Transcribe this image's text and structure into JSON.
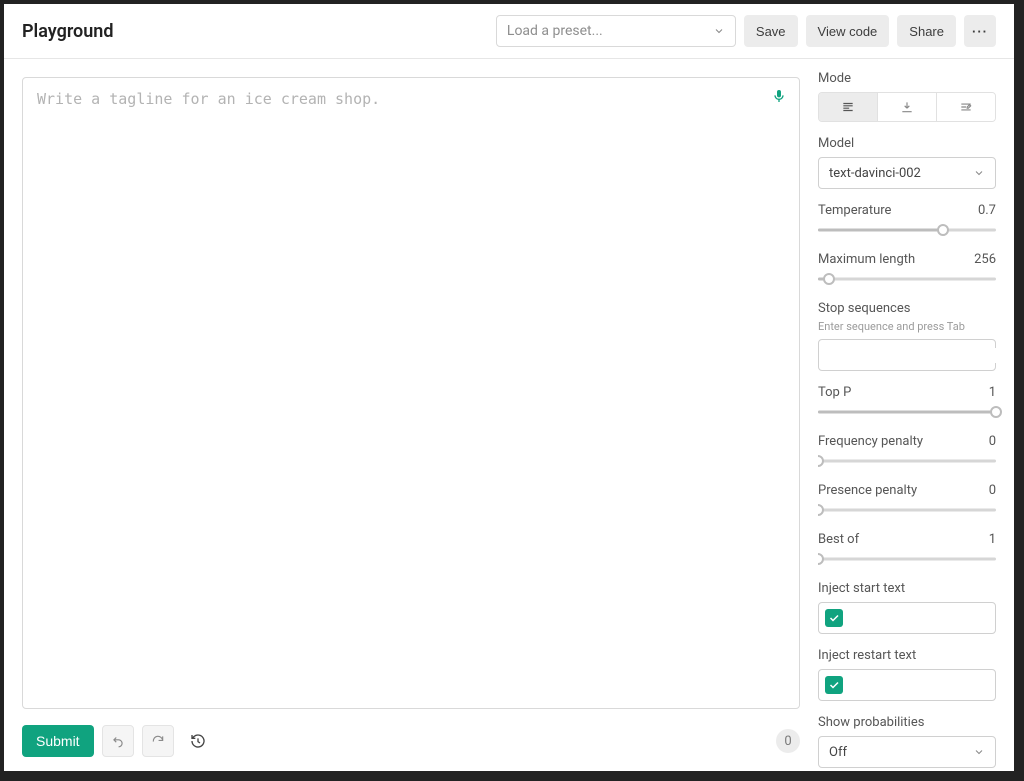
{
  "header": {
    "title": "Playground",
    "preset_placeholder": "Load a preset...",
    "save": "Save",
    "view_code": "View code",
    "share": "Share"
  },
  "editor": {
    "placeholder": "Write a tagline for an ice cream shop.",
    "submit": "Submit",
    "counter": "0"
  },
  "sidebar": {
    "mode_label": "Mode",
    "model_label": "Model",
    "model_value": "text-davinci-002",
    "temperature": {
      "label": "Temperature",
      "value": "0.7",
      "pct": 70
    },
    "max_length": {
      "label": "Maximum length",
      "value": "256",
      "pct": 6
    },
    "stop": {
      "label": "Stop sequences",
      "help": "Enter sequence and press Tab",
      "value": ""
    },
    "top_p": {
      "label": "Top P",
      "value": "1",
      "pct": 100
    },
    "freq": {
      "label": "Frequency penalty",
      "value": "0",
      "pct": 0
    },
    "pres": {
      "label": "Presence penalty",
      "value": "0",
      "pct": 0
    },
    "best_of": {
      "label": "Best of",
      "value": "1",
      "pct": 0
    },
    "inject_start": {
      "label": "Inject start text",
      "checked": true
    },
    "inject_restart": {
      "label": "Inject restart text",
      "checked": true
    },
    "show_prob": {
      "label": "Show probabilities",
      "value": "Off"
    }
  }
}
